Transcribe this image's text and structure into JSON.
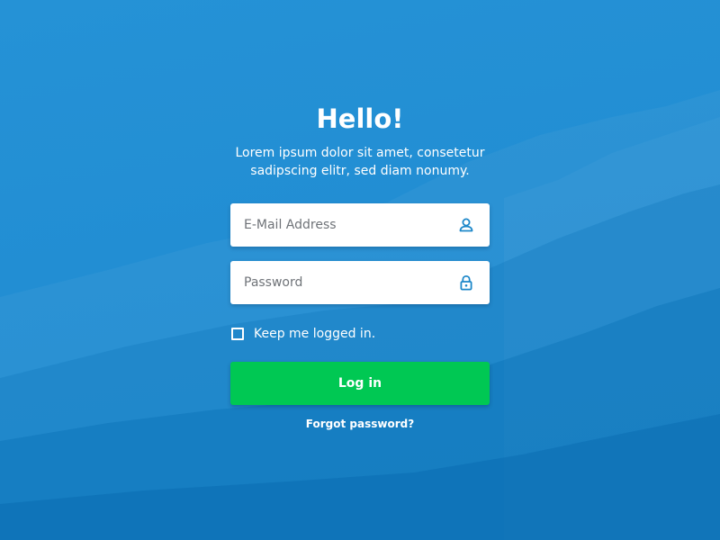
{
  "colors": {
    "background": "#2791d4",
    "background_dark": "#0a78bf",
    "accent_icon": "#1c87c9",
    "login_button": "#00c853",
    "text_on_background": "#ffffff"
  },
  "header": {
    "title": "Hello!",
    "subtitle_line1": "Lorem ipsum dolor sit amet, consetetur",
    "subtitle_line2": "sadipscing elitr, sed diam nonumy."
  },
  "form": {
    "email": {
      "value": "",
      "placeholder": "E-Mail Address",
      "icon": "user-icon"
    },
    "password": {
      "value": "",
      "placeholder": "Password",
      "icon": "lock-icon"
    },
    "remember": {
      "label": "Keep me logged in.",
      "checked": false
    },
    "login_label": "Log in",
    "forgot_label": "Forgot password?"
  }
}
